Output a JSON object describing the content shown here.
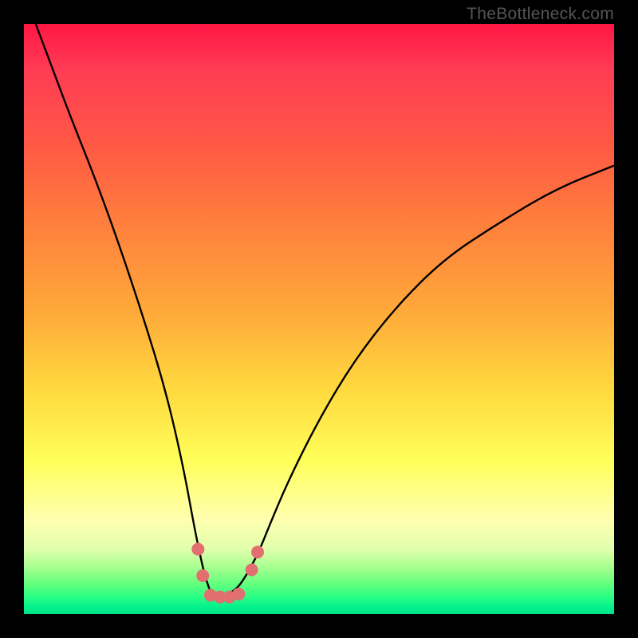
{
  "attribution": {
    "text": "TheBottleneck.com"
  },
  "chart_data": {
    "type": "line",
    "title": "",
    "xlabel": "",
    "ylabel": "",
    "xlim": [
      0,
      100
    ],
    "ylim": [
      0,
      100
    ],
    "grid": false,
    "legend": false,
    "annotations": [
      "TheBottleneck.com"
    ],
    "series": [
      {
        "name": "bottleneck-curve",
        "x": [
          2,
          5,
          8,
          12,
          16,
          20,
          24,
          27,
          29,
          30.5,
          31.5,
          32,
          32.5,
          33,
          34,
          35,
          36,
          37,
          38.5,
          40,
          42,
          45,
          50,
          56,
          63,
          71,
          80,
          90,
          100
        ],
        "y": [
          100,
          92,
          84,
          74,
          63,
          51,
          38,
          25,
          14,
          7,
          4,
          3,
          3,
          3,
          3.2,
          3.6,
          4.3,
          5.5,
          8,
          11,
          16,
          23,
          33,
          43,
          52,
          60,
          66,
          72,
          76
        ]
      }
    ],
    "markers": [
      {
        "name": "left-upper-marker",
        "x": 29.5,
        "y": 11
      },
      {
        "name": "left-lower-marker",
        "x": 30.3,
        "y": 6.5
      },
      {
        "name": "right-lower-marker",
        "x": 38.6,
        "y": 7.5
      },
      {
        "name": "right-upper-marker",
        "x": 39.6,
        "y": 10.5
      },
      {
        "name": "bottom-marker-1",
        "x": 31.6,
        "y": 3.2
      },
      {
        "name": "bottom-marker-2",
        "x": 33.2,
        "y": 2.9
      },
      {
        "name": "bottom-marker-3",
        "x": 34.8,
        "y": 2.9
      },
      {
        "name": "bottom-marker-4",
        "x": 36.4,
        "y": 3.4
      }
    ],
    "marker_color": "#e16f70",
    "curve_color": "#000000",
    "gradient_stops": [
      {
        "pos": 0,
        "color": "#ff1744"
      },
      {
        "pos": 8,
        "color": "#ff3d55"
      },
      {
        "pos": 20,
        "color": "#ff5745"
      },
      {
        "pos": 32,
        "color": "#ff7a3d"
      },
      {
        "pos": 48,
        "color": "#ffa73a"
      },
      {
        "pos": 62,
        "color": "#ffd93e"
      },
      {
        "pos": 74,
        "color": "#ffff5a"
      },
      {
        "pos": 84,
        "color": "#ffffb0"
      },
      {
        "pos": 89,
        "color": "#e0ffad"
      },
      {
        "pos": 92,
        "color": "#a8ff90"
      },
      {
        "pos": 95,
        "color": "#61ff7e"
      },
      {
        "pos": 97,
        "color": "#2cff85"
      },
      {
        "pos": 99,
        "color": "#00ef8b"
      },
      {
        "pos": 100,
        "color": "#00e08a"
      }
    ]
  }
}
